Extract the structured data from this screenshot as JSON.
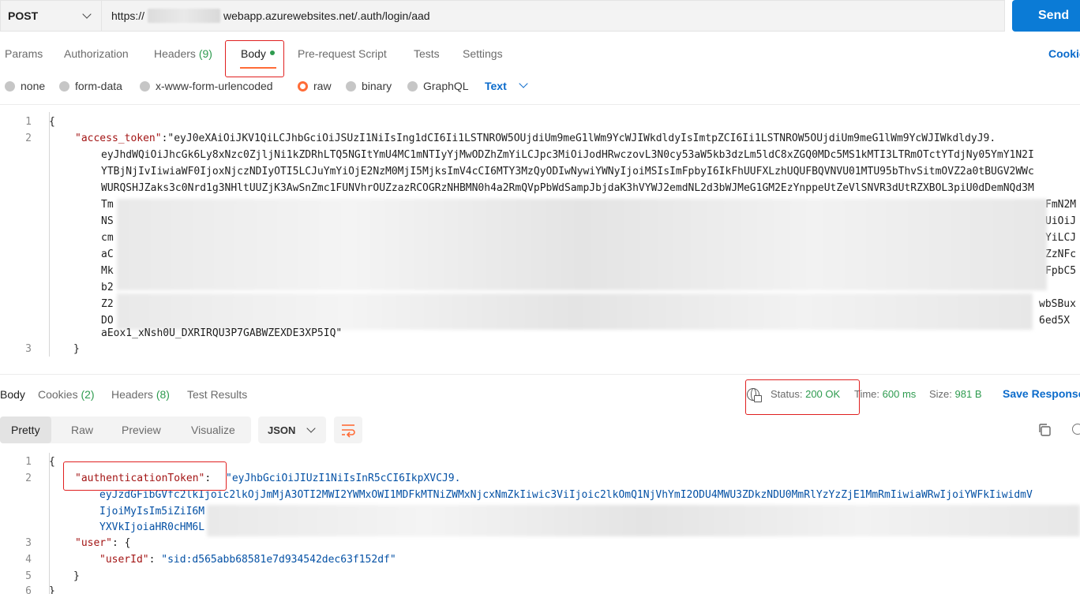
{
  "request": {
    "method": "POST",
    "url_prefix": "https://",
    "url_suffix": "webapp.azurewebsites.net/.auth/login/aad",
    "send_label": "Send"
  },
  "request_tabs": {
    "params": "Params",
    "authorization": "Authorization",
    "headers": "Headers",
    "headers_count": "(9)",
    "body": "Body",
    "pre_request": "Pre-request Script",
    "tests": "Tests",
    "settings": "Settings",
    "cookies": "Cookies"
  },
  "body_modes": {
    "none": "none",
    "form_data": "form-data",
    "urlencoded": "x-www-form-urlencoded",
    "raw": "raw",
    "binary": "binary",
    "graphql": "GraphQL",
    "selected": "raw",
    "text_type": "Text"
  },
  "request_body": {
    "line_numbers": [
      "1",
      "2",
      "3"
    ],
    "open_brace": "{",
    "close_brace": "}",
    "token_key": "\"access_token\"",
    "token_line_1": ":\"eyJ0eXAiOiJKV1QiLCJhbGciOiJSUzI1NiIsIng1dCI6Ii1LSTNROW5OUjdiUm9meG1lWm9YcWJIWkdldyIsImtpZCI6Ii1LSTNROW5OUjdiUm9meG1lWm9YcWJIWkdldyJ9.",
    "token_line_2": "eyJhdWQiOiJhcGk6Ly8xNzc0ZjljNi1kZDRhLTQ5NGItYmU4MC1mNTIyYjMwODZhZmYiLCJpc3MiOiJodHRwczovL3N0cy53aW5kb3dzLm5ldC8xZGQ0MDc5MS1kMTI3LTRmOTctYTdjNy05YmY1N2I",
    "token_line_3": "YTBjNjIvIiwiaWF0IjoxNjczNDIyOTI5LCJuYmYiOjE2NzM0MjI5MjksImV4cCI6MTY3MzQyODIwNywiYWNyIjoiMSIsImFpbyI6IkFhUUFXLzhUQUFBQVNVU01MTU95bThvSitmOVZ2a0tBUGV2WWc",
    "token_line_4": "WURQSHJZaks3c0Nrd1g3NHltUUZjK3AwSnZmc1FUNVhrOUZzazRCOGRzNHBMN0h4a2RmQVpPbWdSampJbjdaK3hVYWJ2emdNL2d3bWJMeG1GM2EzYnppeUtZeVlSNVR3dUtRZXBOL3piU0dDemNQd3M",
    "token_row_prefixes": [
      "Tm",
      "NS",
      "cm",
      "aC",
      "Mk",
      "b2",
      "Z2",
      "DO"
    ],
    "token_row_suffixes": [
      "FmN2M",
      "UiOiJ",
      "YiLCJ",
      "ZzNFc",
      "FpbC5",
      "",
      "wbSBux",
      "6ed5X"
    ],
    "token_last": "aEox1_xNsh0U_DXRIRQU3P7GABWZEXDE3XP5IQ\""
  },
  "response_tabs": {
    "body": "Body",
    "cookies": "Cookies",
    "cookies_count": "(2)",
    "headers": "Headers",
    "headers_count": "(8)",
    "test_results": "Test Results"
  },
  "response_status": {
    "status_label": "Status:",
    "status_value": "200 OK",
    "time_label": "Time:",
    "time_value": "600 ms",
    "size_label": "Size:",
    "size_value": "981 B",
    "save_response": "Save Response"
  },
  "response_view": {
    "pretty": "Pretty",
    "raw": "Raw",
    "preview": "Preview",
    "visualize": "Visualize",
    "format": "JSON"
  },
  "response_body": {
    "line_numbers": [
      "1",
      "2",
      "3",
      "4",
      "5",
      "6"
    ],
    "open_brace": "{",
    "close_brace": "}",
    "auth_key": "\"authenticationToken\"",
    "colon": ": ",
    "auth_line_1": "\"eyJhbGciOiJIUzI1NiIsInR5cCI6IkpXVCJ9.",
    "auth_line_2": "eyJzdGFibGVfc2lkIjoic2lkOjJmMjA3OTI2MWI2YWMxOWI1MDFkMTNiZWMxNjcxNmZkIiwic3ViIjoic2lkOmQ1NjVhYmI2ODU4MWU3ZDkzNDU0MmRlYzYzZjE1MmRmIiwiaWRwIjoiYWFkIiwidmV",
    "auth_line_3": "IjoiMyIsIm5iZiI6M",
    "auth_line_4": "YXVkIjoiaHR0cHM6L",
    "user_key": "\"user\"",
    "user_open": ": {",
    "user_id_key": "\"userId\"",
    "user_id_value": "\"sid:d565abb68581e7d934542dec63f152df\"",
    "user_close": "}"
  },
  "colors": {
    "accent_orange": "#ff6c37",
    "send_blue": "#0b7bd6",
    "status_green": "#2e9b4f",
    "annotation_red": "#e02020"
  },
  "icons": [
    "chevron-down-icon",
    "globe-lock-icon",
    "wrap-lines-icon",
    "copy-icon",
    "search-icon"
  ]
}
